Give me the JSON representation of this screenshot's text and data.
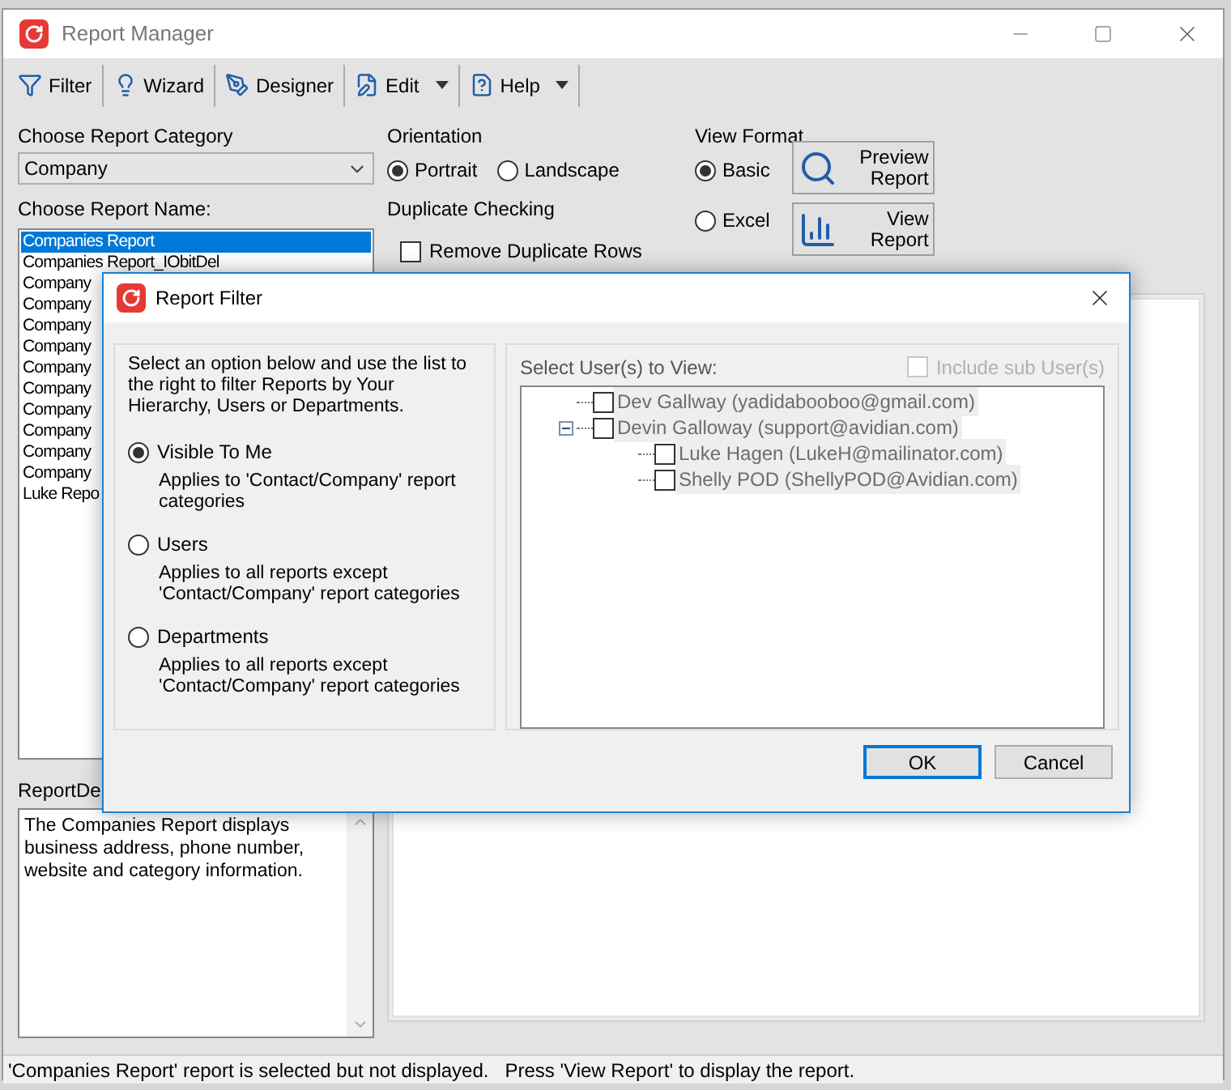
{
  "window": {
    "title": "Report Manager"
  },
  "toolbar": [
    {
      "label": "Filter",
      "kind": "filter",
      "dropdown": false
    },
    {
      "label": "Wizard",
      "kind": "wizard",
      "dropdown": false
    },
    {
      "label": "Designer",
      "kind": "designer",
      "dropdown": false
    },
    {
      "label": "Edit",
      "kind": "edit",
      "dropdown": true
    },
    {
      "label": "Help",
      "kind": "help",
      "dropdown": true
    }
  ],
  "report_category": {
    "label": "Choose Report Category",
    "value": "Company"
  },
  "report_name": {
    "label": "Choose Report Name:",
    "items": [
      {
        "text": "Companies Report",
        "selected": true
      },
      {
        "text": "Companies Report_IObitDel",
        "selected": false
      },
      {
        "text": "Company",
        "selected": false
      },
      {
        "text": "Company",
        "selected": false
      },
      {
        "text": "Company",
        "selected": false
      },
      {
        "text": "Company",
        "selected": false
      },
      {
        "text": "Company",
        "selected": false
      },
      {
        "text": "Company",
        "selected": false
      },
      {
        "text": "Company",
        "selected": false
      },
      {
        "text": "Company",
        "selected": false
      },
      {
        "text": "Company",
        "selected": false
      },
      {
        "text": "Company",
        "selected": false
      },
      {
        "text": "Luke Repo",
        "selected": false
      }
    ]
  },
  "orientation": {
    "title": "Orientation",
    "options": [
      {
        "label": "Portrait",
        "selected": true
      },
      {
        "label": "Landscape",
        "selected": false
      }
    ]
  },
  "duplicate_checking": {
    "title": "Duplicate Checking",
    "option": {
      "label": "Remove Duplicate Rows",
      "checked": false
    }
  },
  "view_format": {
    "title": "View Format",
    "options": [
      {
        "label": "Basic",
        "selected": true
      },
      {
        "label": "Excel",
        "selected": false
      }
    ],
    "buttons": [
      {
        "label": "Preview Report",
        "kind": "preview"
      },
      {
        "label": "View Report",
        "kind": "view"
      }
    ]
  },
  "description": {
    "label": "ReportDe",
    "text": "The Companies Report displays business address, phone number, website and category information."
  },
  "status_bar": "'Companies Report' report is selected but not displayed.   Press 'View Report' to display the report.",
  "dialog": {
    "title": "Report Filter",
    "intro": "Select an option below and use the list to the right to filter Reports by Your Hierarchy, Users or Departments.",
    "options": [
      {
        "label": "Visible To Me",
        "description": "Applies to 'Contact/Company' report categories",
        "selected": true
      },
      {
        "label": "Users",
        "description": "Applies to all reports except 'Contact/Company' report categories",
        "selected": false
      },
      {
        "label": "Departments",
        "description": "Applies to all reports except 'Contact/Company' report categories",
        "selected": false
      }
    ],
    "users": {
      "label": "Select User(s) to View:",
      "disabled": true,
      "include_sub": {
        "label": "Include sub User(s)",
        "checked": false,
        "disabled": true
      },
      "tree": [
        {
          "name": "Dev Gallway (yadidabooboo@gmail.com)",
          "checked": false
        },
        {
          "name": "Devin Galloway (support@avidian.com)",
          "checked": false,
          "expanded": true,
          "children": [
            {
              "name": "Luke Hagen (LukeH@mailinator.com)",
              "checked": false
            },
            {
              "name": "Shelly POD (ShellyPOD@Avidian.com)",
              "checked": false
            }
          ]
        }
      ]
    },
    "buttons": [
      {
        "label": "OK",
        "default": true
      },
      {
        "label": "Cancel",
        "default": false
      }
    ]
  }
}
